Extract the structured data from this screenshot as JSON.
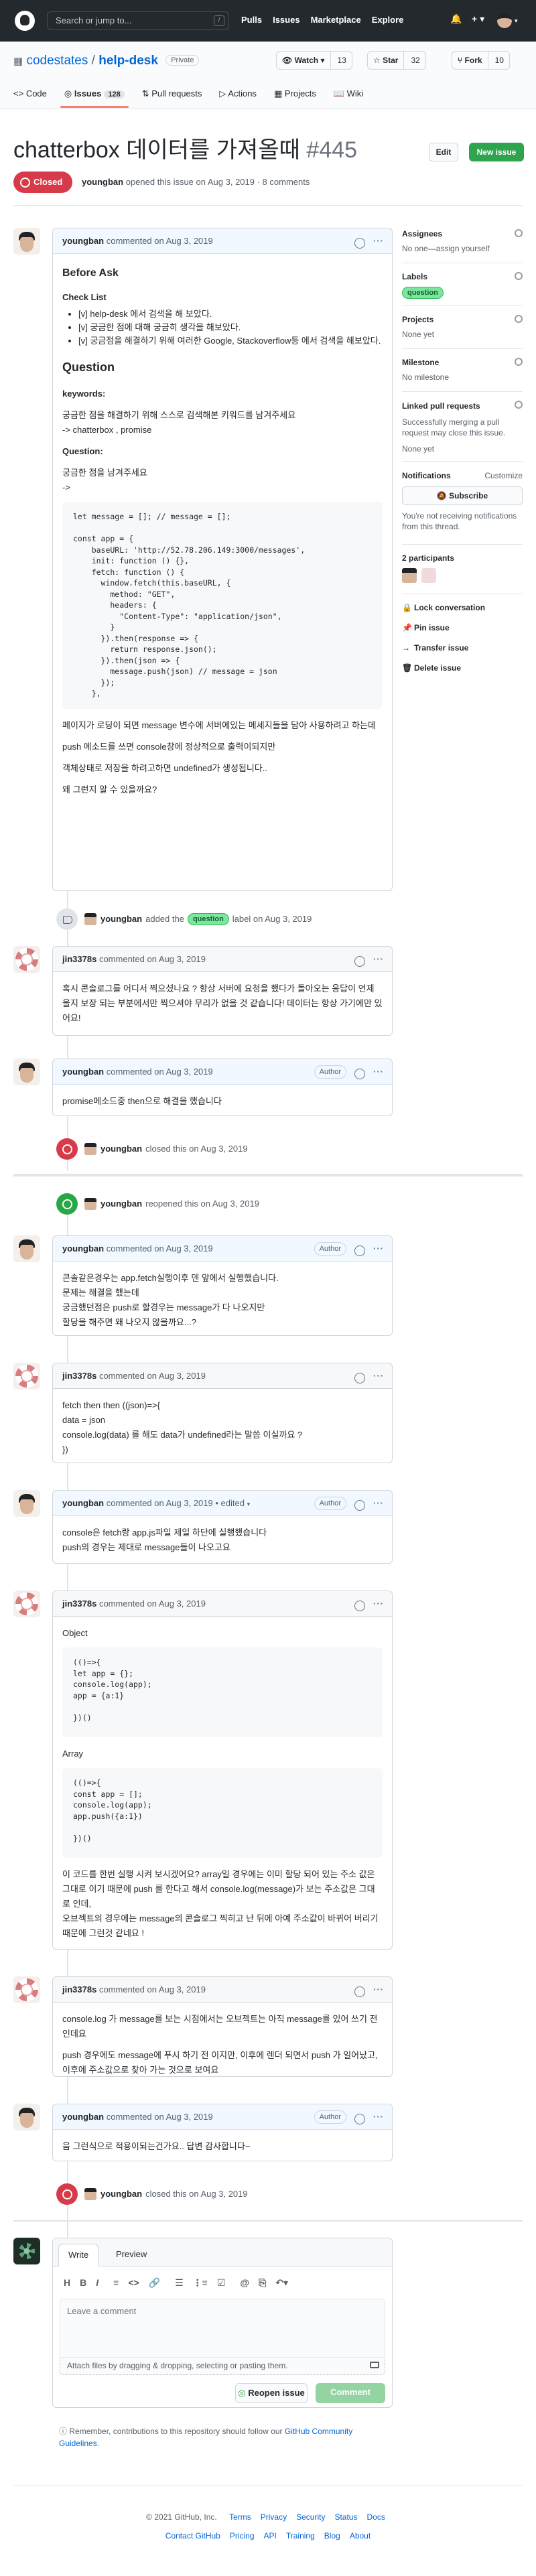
{
  "header": {
    "search_placeholder": "Search or jump to...",
    "search_key": "/",
    "nav": [
      "Pulls",
      "Issues",
      "Marketplace",
      "Explore"
    ]
  },
  "repo": {
    "owner": "codestates",
    "slash": "/",
    "name": "help-desk",
    "visibility": "Private",
    "watch_label": "Watch",
    "watch_count": "13",
    "star_label": "Star",
    "star_count": "32",
    "fork_label": "Fork",
    "fork_count": "10",
    "tabs": [
      {
        "label": "Code"
      },
      {
        "label": "Issues",
        "count": "128"
      },
      {
        "label": "Pull requests"
      },
      {
        "label": "Actions"
      },
      {
        "label": "Projects"
      },
      {
        "label": "Wiki"
      }
    ]
  },
  "issue": {
    "title": "chatterbox 데이터를 가져올때",
    "number": "#445",
    "edit_label": "Edit",
    "new_issue_label": "New issue",
    "state": "Closed",
    "author": "youngban",
    "meta": "opened this issue on Aug 3, 2019 · 8 comments"
  },
  "comments": [
    {
      "author": "youngban",
      "date": "commented on Aug 3, 2019",
      "heading": "Before Ask",
      "checklist_title": "Check List",
      "checklist": [
        "[v] help-desk 에서 검색을 해 보았다.",
        "[v] 궁금한 점에 대해 궁금히 생각을 해보았다.",
        "[v] 궁금점을 해결하기 위해 여러한 Google, Stackoverflow등 에서 검색을 해보았다."
      ],
      "question_title": "Question",
      "keywords_label": "keywords:",
      "keywords_text": "궁금한 점을 해결하기 위해 스스로 검색해본 키워드를 남겨주세요",
      "keywords_value": "-> chatterbox , promise",
      "question_label": "Question:",
      "question_text": "궁금한 점을 남겨주세요",
      "arrow": "->",
      "code": "let message = []; // message = [];\n\nconst app = {\n    baseURL: 'http://52.78.206.149:3000/messages',\n    init: function () {},\n    fetch: function () {\n      window.fetch(this.baseURL, {\n        method: \"GET\",\n        headers: {\n          \"Content-Type\": \"application/json\",\n        }\n      }).then(response => {\n        return response.json();\n      }).then(json => {\n        message.push(json) // message = json\n      });\n    },",
      "p1": "페이지가 로딩이 되면 message 변수에 서버에있는 메세지들을 담아 사용하려고 하는데",
      "p2": "push 메소드를 쓰면 console창에 정상적으로 출력이되지만",
      "p3": "객체상태로 저장을 하려고하면 undefined가 생성됩니다..",
      "p4": "왜 그런지 알 수 있을까요?"
    },
    {
      "author": "jin3378s",
      "date": "commented on Aug 3, 2019",
      "body": "혹시 콘솔로그를 어디서 찍으셨나요 ? 항상 서버에 요청을 했다가 돌아오는 응답이 언제 올지 보장 되는 부분에서만 찍으셔야 무리가 없을 것 같습니다! 데이터는 항상 가기에만 있어요!"
    },
    {
      "author": "youngban",
      "badge": "Author",
      "date": "commented on Aug 3, 2019",
      "body": "promise메소드중 then으로 해결을 했습니다"
    },
    {
      "author": "youngban",
      "badge": "Author",
      "date": "commented on Aug 3, 2019",
      "l1": "콘솔같은경우는 app.fetch실행이후 덴 앞에서 실행했습니다.",
      "l2": "문제는 해결을 했는데",
      "l3": "궁금했던점은 push로 할경우는 message가 다 나오지만",
      "l4": "할당을 해주면 왜 나오지 않을까요...?"
    },
    {
      "author": "jin3378s",
      "date": "commented on Aug 3, 2019",
      "l1": "fetch then then ((json)=>{",
      "l2": "data = json",
      "l3": "console.log(data) 를 해도 data가 undefined라는 말씀 이실까요 ?",
      "l4": "})"
    },
    {
      "author": "youngban",
      "badge": "Author",
      "date": "commented on Aug 3, 2019 • edited",
      "l1": "console은 fetch랑 app.js파일 제일 하단에 실행했습니다",
      "l2": "push의 경우는 제대로 message들이 나오고요"
    },
    {
      "author": "jin3378s",
      "date": "commented on Aug 3, 2019",
      "object_label": "Object",
      "code1": "(()=>{\nlet app = {};\nconsole.log(app);\napp = {a:1}\n\n})()",
      "array_label": "Array",
      "code2": "(()=>{\nconst app = [];\nconsole.log(app);\napp.push({a:1})\n\n})()",
      "p1": "이 코드를 한번 실행 시켜 보시겠어요? array일 경우에는 이미 할당 되어 있는 주소 값은 그대로 이기 때문에 push 를 한다고 해서 console.log(message)가 보는 주소값은 그대로 인데,",
      "p2": "오브젝트의 경우에는 message의 콘솔로그 찍히고 난 뒤에 아예 주소값이 바뀌어 버리기 때문에 그런것 같네요 !"
    },
    {
      "author": "jin3378s",
      "date": "commented on Aug 3, 2019",
      "p1": "console.log 가 message를 보는 시점에서는 오브젝트는 아직 message를 있어 쓰기 전인데요",
      "p2": "push 경우에도 message에 푸시 하기 전 이지만, 이후에 렌더 되면서 push 가 일어났고, 이후에 주소값으로 찾아 가는 것으로 보여요"
    },
    {
      "author": "youngban",
      "badge": "Author",
      "date": "commented on Aug 3, 2019",
      "body": "음 그런식으로 적용이되는건가요.. 답변 감사합니다~"
    }
  ],
  "events": {
    "labeled": {
      "actor": "youngban",
      "before": "added the",
      "label": "question",
      "after": "label on Aug 3, 2019"
    },
    "closed1": {
      "actor": "youngban",
      "text": "closed this on Aug 3, 2019"
    },
    "reopened": {
      "actor": "youngban",
      "text": "reopened this on Aug 3, 2019"
    },
    "closed2": {
      "actor": "youngban",
      "text": "closed this on Aug 3, 2019"
    }
  },
  "sidebar": {
    "assignees": "Assignees",
    "assignees_value": "No one—assign yourself",
    "labels": "Labels",
    "label_value": "question",
    "projects": "Projects",
    "projects_value": "None yet",
    "milestone": "Milestone",
    "milestone_value": "No milestone",
    "linked": "Linked pull requests",
    "linked_desc": "Successfully merging a pull request may close this issue.",
    "linked_value": "None yet",
    "notifications": "Notifications",
    "customize": "Customize",
    "subscribe": "Subscribe",
    "notif_desc": "You're not receiving notifications from this thread.",
    "participants": "2 participants",
    "lock": "Lock conversation",
    "pin": "Pin issue",
    "transfer": "Transfer issue",
    "delete": "Delete issue"
  },
  "editor": {
    "write": "Write",
    "preview": "Preview",
    "placeholder": "Leave a comment",
    "attach": "Attach files by dragging & dropping, selecting or pasting them.",
    "reopen": "Reopen issue",
    "comment": "Comment"
  },
  "note": {
    "text": "Remember, contributions to this repository should follow our",
    "link": "GitHub Community Guidelines",
    "end": "."
  },
  "footer": {
    "copyright": "© 2021 GitHub, Inc.",
    "row1": [
      "Terms",
      "Privacy",
      "Security",
      "Status",
      "Docs"
    ],
    "row2": [
      "Contact GitHub",
      "Pricing",
      "API",
      "Training",
      "Blog",
      "About"
    ]
  }
}
